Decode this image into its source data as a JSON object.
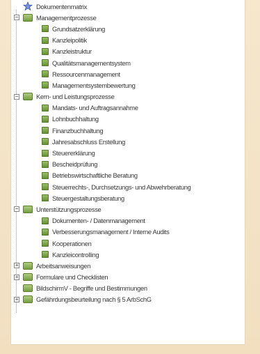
{
  "tree": {
    "root": {
      "label": "Dokumentenmatrix"
    },
    "groups": [
      {
        "label": "Managementprozesse",
        "expanded": true,
        "children": [
          "Grundsatzerklärung",
          "Kanzleipolitik",
          "Kanzleistruktur",
          "Qualitätsmanagementsystem",
          "Ressourcenmanagement",
          "Managementsystembewertung"
        ]
      },
      {
        "label": "Kern- und Leistungsprozesse",
        "expanded": true,
        "children": [
          "Mandats- und Auftragsannahme",
          "Lohnbuchhaltung",
          "Finanzbuchhaltung",
          "Jahresabschluss Erstellung",
          "Steuererklärung",
          "Bescheidprüfung",
          "Betriebswirtschaftliche Beratung",
          "Steuerrechts-, Durchsetzungs- und Abwehrberatung",
          "Steuergestaltungsberatung"
        ]
      },
      {
        "label": "Unterstützungsprozesse",
        "expanded": true,
        "children": [
          "Dokumenten- / Datenmanagement",
          "Verbesserungsmanagement / Interne Audits",
          "Kooperationen",
          "Kanzleicontrolling"
        ]
      },
      {
        "label": "Arbeitsanweisungen",
        "expanded": false,
        "children": []
      },
      {
        "label": "Formulare und Checklisten",
        "expanded": false,
        "children": []
      },
      {
        "label": "BildschirmV - Begriffe und Bestimmungen",
        "expanded": false,
        "children": [],
        "no_expander": true
      },
      {
        "label": "Gefährdungsbeurteilung nach § 5 ArbSchG",
        "expanded": false,
        "children": []
      }
    ]
  },
  "colors": {
    "background": "#f2e2c6",
    "panel": "#ffffff",
    "folder_icon": "#7ba243",
    "root_star": "#3a56b8"
  },
  "icons": {
    "root": "star-icon",
    "group": "folder-icon",
    "item": "document-icon"
  }
}
